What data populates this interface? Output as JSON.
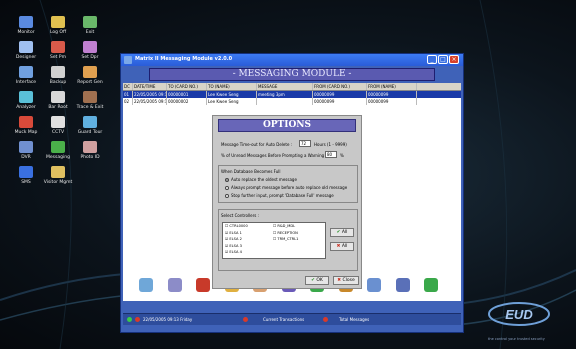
{
  "desktop": {
    "icons": [
      {
        "label": "Monitor",
        "icon": "monitor-icon"
      },
      {
        "label": "Log Off",
        "icon": "user-icon"
      },
      {
        "label": "Exit",
        "icon": "building-icon"
      },
      {
        "label": "Designer",
        "icon": "designer-icon"
      },
      {
        "label": "Set Pm",
        "icon": "pm-icon"
      },
      {
        "label": "Set Dpr",
        "icon": "dpr-icon"
      },
      {
        "label": "Interface",
        "icon": "interface-icon"
      },
      {
        "label": "Backup",
        "icon": "backup-icon"
      },
      {
        "label": "Report Gen",
        "icon": "report-icon"
      },
      {
        "label": "Analyzer",
        "icon": "analyzer-icon"
      },
      {
        "label": "Bar Root",
        "icon": "root-icon"
      },
      {
        "label": "Trace & Exit",
        "icon": "trace-icon"
      },
      {
        "label": "Muck Map",
        "icon": "map-icon"
      },
      {
        "label": "CCTV",
        "icon": "cctv-icon"
      },
      {
        "label": "Guard Tour",
        "icon": "guard-icon"
      },
      {
        "label": "DVR",
        "icon": "dvr-icon"
      },
      {
        "label": "Messaging",
        "icon": "messaging-icon"
      },
      {
        "label": "Photo ID",
        "icon": "photo-id-icon"
      },
      {
        "label": "SMS",
        "icon": "sms-icon"
      },
      {
        "label": "Visitor Mgmt",
        "icon": "visitor-icon"
      }
    ],
    "logo_text": "EUD",
    "footer_text": "the control your trusted security"
  },
  "window": {
    "title": "Matrix II Messaging Module v2.0.0",
    "header": "- MESSAGING MODULE -",
    "columns": [
      "DC",
      "DATE/TIME",
      "TO (CARD NO.)",
      "TO (NAME)",
      "MESSAGE",
      "FROM (CARD NO.)",
      "FROM (NAME)"
    ],
    "rows": [
      [
        "01",
        "22/05/2005 09:14",
        "00000001",
        "Lee Kwee Seng",
        "meeting 3pm",
        "00000099",
        "00000099"
      ],
      [
        "02",
        "22/05/2005 09:14",
        "00000002",
        "Lee Kwee Seng",
        "",
        "00000099",
        "00000099"
      ]
    ],
    "toolbar": [
      {
        "label": "New",
        "icon": "new-icon",
        "color": "#6fa7d8"
      },
      {
        "label": "Edit",
        "icon": "edit-icon",
        "color": "#8c8cc8"
      },
      {
        "label": "Delete",
        "icon": "delete-icon",
        "color": "#c83a2a"
      },
      {
        "label": "Send",
        "icon": "send-icon",
        "color": "#e0b040"
      },
      {
        "label": "Send All",
        "icon": "send-all-icon",
        "color": "#d8a070"
      },
      {
        "label": "Recipient",
        "icon": "recipient-icon",
        "color": "#6a5ab8"
      },
      {
        "label": "Controller",
        "icon": "controller-icon",
        "color": "#3aa84a"
      },
      {
        "label": "Options",
        "icon": "options-icon",
        "color": "#c8882a"
      },
      {
        "label": "Report",
        "icon": "report-icon",
        "color": "#6a90d0"
      },
      {
        "label": "About",
        "icon": "about-icon",
        "color": "#5a70b8"
      },
      {
        "label": "Exit",
        "icon": "exit-icon",
        "color": "#3aa84a"
      }
    ],
    "status": {
      "datetime": "22/05/2005 09:13 Friday",
      "current_label": "Current Transactions",
      "total_label": "Total Messages"
    }
  },
  "options": {
    "title": "OPTIONS",
    "timeout_label": "Message Time-out for Auto Delete :",
    "timeout_value": "72",
    "timeout_unit": "Hours (1 - 9999)",
    "warning_label": "% of Unread Messages Before Prompting a Warning :",
    "warning_value": "80",
    "warning_unit": "%",
    "db_full_label": "When Database Becomes Full",
    "radios": [
      {
        "label": "Auto replace the oldest message",
        "checked": true
      },
      {
        "label": "Always prompt message before auto replace old message",
        "checked": false
      },
      {
        "label": "Stop further input, prompt 'Database Full' message",
        "checked": false
      }
    ],
    "controllers_label": "Select Controllers :",
    "controllers_left": [
      "CTRL0000",
      "ELSA 1",
      "ELSA 2",
      "ELSA 3",
      "ELSA 4"
    ],
    "controllers_right": [
      "R&D_MDL",
      "RECEPTION",
      "TRM_CTRL1"
    ],
    "all_button": "All",
    "none_button": "All",
    "ok_button": "OK",
    "close_button": "Close"
  }
}
